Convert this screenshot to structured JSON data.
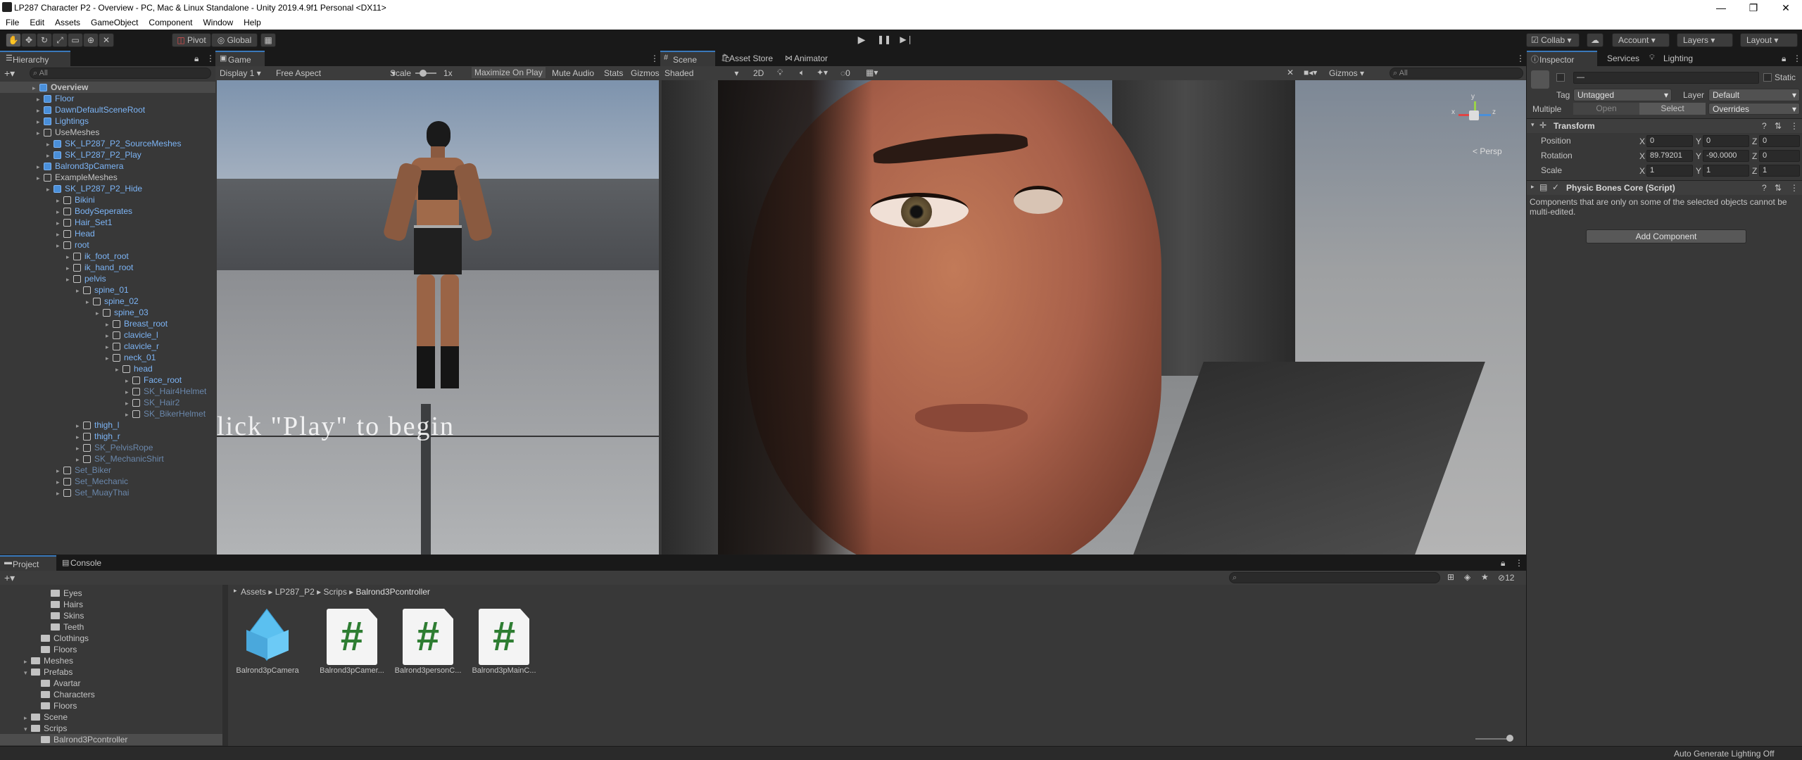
{
  "window": {
    "title": "LP287 Character P2 - Overview - PC, Mac & Linux Standalone - Unity 2019.4.9f1 Personal <DX11>",
    "minimize": "—",
    "maximize": "❐",
    "close": "✕"
  },
  "menu": [
    "File",
    "Edit",
    "Assets",
    "GameObject",
    "Component",
    "Window",
    "Help"
  ],
  "toolbar": {
    "pivot": "Pivot",
    "global": "Global",
    "collab": "Collab",
    "account": "Account",
    "layers": "Layers",
    "layout": "Layout"
  },
  "hierarchy": {
    "tab": "Hierarchy",
    "search_placeholder": "All",
    "rows": [
      {
        "label": "Overview",
        "depth": 0,
        "type": "scene"
      },
      {
        "label": "Floor",
        "depth": 1,
        "type": "prefab"
      },
      {
        "label": "DawnDefaultSceneRoot",
        "depth": 1,
        "type": "prefab"
      },
      {
        "label": "Lightings",
        "depth": 1,
        "type": "prefab"
      },
      {
        "label": "UseMeshes",
        "depth": 1,
        "type": "object"
      },
      {
        "label": "SK_LP287_P2_SourceMeshes",
        "depth": 2,
        "type": "prefab"
      },
      {
        "label": "SK_LP287_P2_Play",
        "depth": 2,
        "type": "prefab"
      },
      {
        "label": "Balrond3pCamera",
        "depth": 1,
        "type": "prefab"
      },
      {
        "label": "ExampleMeshes",
        "depth": 1,
        "type": "object"
      },
      {
        "label": "SK_LP287_P2_Hide",
        "depth": 2,
        "type": "prefab"
      },
      {
        "label": "Bikini",
        "depth": 3,
        "type": "object-blue"
      },
      {
        "label": "BodySeperates",
        "depth": 3,
        "type": "object-blue"
      },
      {
        "label": "Hair_Set1",
        "depth": 3,
        "type": "object-blue"
      },
      {
        "label": "Head",
        "depth": 3,
        "type": "object-blue"
      },
      {
        "label": "root",
        "depth": 3,
        "type": "object-blue"
      },
      {
        "label": "ik_foot_root",
        "depth": 4,
        "type": "object-blue"
      },
      {
        "label": "ik_hand_root",
        "depth": 4,
        "type": "object-blue"
      },
      {
        "label": "pelvis",
        "depth": 4,
        "type": "object-blue"
      },
      {
        "label": "spine_01",
        "depth": 5,
        "type": "object-blue"
      },
      {
        "label": "spine_02",
        "depth": 6,
        "type": "object-blue"
      },
      {
        "label": "spine_03",
        "depth": 7,
        "type": "object-blue"
      },
      {
        "label": "Breast_root",
        "depth": 8,
        "type": "object-blue"
      },
      {
        "label": "clavicle_l",
        "depth": 8,
        "type": "object-blue"
      },
      {
        "label": "clavicle_r",
        "depth": 8,
        "type": "object-blue"
      },
      {
        "label": "neck_01",
        "depth": 8,
        "type": "object-blue"
      },
      {
        "label": "head",
        "depth": 9,
        "type": "object-blue"
      },
      {
        "label": "Face_root",
        "depth": 10,
        "type": "object-blue"
      },
      {
        "label": "SK_Hair4Helmet",
        "depth": 10,
        "type": "dim"
      },
      {
        "label": "SK_Hair2",
        "depth": 10,
        "type": "dim"
      },
      {
        "label": "SK_BikerHelmet",
        "depth": 10,
        "type": "dim"
      },
      {
        "label": "thigh_l",
        "depth": 5,
        "type": "object-blue"
      },
      {
        "label": "thigh_r",
        "depth": 5,
        "type": "object-blue"
      },
      {
        "label": "SK_PelvisRope",
        "depth": 5,
        "type": "dim"
      },
      {
        "label": "SK_MechanicShirt",
        "depth": 5,
        "type": "dim"
      },
      {
        "label": "Set_Biker",
        "depth": 3,
        "type": "dim"
      },
      {
        "label": "Set_Mechanic",
        "depth": 3,
        "type": "dim"
      },
      {
        "label": "Set_MuayThai",
        "depth": 3,
        "type": "dim"
      }
    ]
  },
  "game": {
    "tab": "Game",
    "display": "Display 1",
    "aspect": "Free Aspect",
    "scale_label": "Scale",
    "scale_value": "1x",
    "maximize": "Maximize On Play",
    "mute": "Mute Audio",
    "stats": "Stats",
    "gizmos": "Gizmos",
    "overlay_text": "lick \"Play\" to begin"
  },
  "scene": {
    "tabs": [
      "Scene",
      "Asset Store",
      "Animator"
    ],
    "shading": "Shaded",
    "mode2d": "2D",
    "fx_count": "0",
    "gizmos": "Gizmos",
    "search_placeholder": "All",
    "persp": "< Persp",
    "gizmo_x": "x",
    "gizmo_y": "y",
    "gizmo_z": "z"
  },
  "inspector": {
    "tabs": [
      "Inspector",
      "Services",
      "Lighting"
    ],
    "name_value": "—",
    "static": "Static",
    "tag_label": "Tag",
    "tag_value": "Untagged",
    "layer_label": "Layer",
    "layer_value": "Default",
    "multiple": "Multiple",
    "open": "Open",
    "select": "Select",
    "overrides": "Overrides",
    "transform": {
      "title": "Transform",
      "rows": [
        {
          "label": "Position",
          "x": "0",
          "y": "0",
          "z": "0"
        },
        {
          "label": "Rotation",
          "x": "89.79201",
          "y": "-90.0000",
          "z": "0"
        },
        {
          "label": "Scale",
          "x": "1",
          "y": "1",
          "z": "1"
        }
      ]
    },
    "component_title": "Physic Bones Core (Script)",
    "multi_note_1": "Components that are only on some of the selected objects cannot be",
    "multi_note_2": "multi-edited.",
    "add_component": "Add Component"
  },
  "project": {
    "tabs": [
      "Project",
      "Console"
    ],
    "count": "12",
    "breadcrumb": [
      "Assets",
      "LP287_P2",
      "Scrips",
      "Balrond3Pcontroller"
    ],
    "tree": [
      {
        "label": "Eyes",
        "depth": 2
      },
      {
        "label": "Hairs",
        "depth": 2
      },
      {
        "label": "Skins",
        "depth": 2
      },
      {
        "label": "Teeth",
        "depth": 2
      },
      {
        "label": "Clothings",
        "depth": 1
      },
      {
        "label": "Floors",
        "depth": 1
      },
      {
        "label": "Meshes",
        "depth": 0,
        "arrow": "▸"
      },
      {
        "label": "Prefabs",
        "depth": 0,
        "arrow": "▾"
      },
      {
        "label": "Avartar",
        "depth": 1
      },
      {
        "label": "Characters",
        "depth": 1
      },
      {
        "label": "Floors",
        "depth": 1
      },
      {
        "label": "Scene",
        "depth": 0,
        "arrow": "▸"
      },
      {
        "label": "Scrips",
        "depth": 0,
        "arrow": "▾"
      },
      {
        "label": "Balrond3Pcontroller",
        "depth": 1,
        "selected": true
      }
    ],
    "assets": [
      {
        "label": "Balrond3pCamera",
        "icon": "prefab-cube-icon"
      },
      {
        "label": "Balrond3pCamer...",
        "icon": "csharp-script-icon"
      },
      {
        "label": "Balrond3personC...",
        "icon": "csharp-script-icon"
      },
      {
        "label": "Balrond3pMainC...",
        "icon": "csharp-script-icon"
      }
    ],
    "hash": "#"
  },
  "status": {
    "text": "Auto Generate Lighting Off"
  },
  "colors": {
    "accent": "#3a79bb",
    "script_green": "#2e7d32",
    "prefab_blue": "#5bc0f0"
  }
}
